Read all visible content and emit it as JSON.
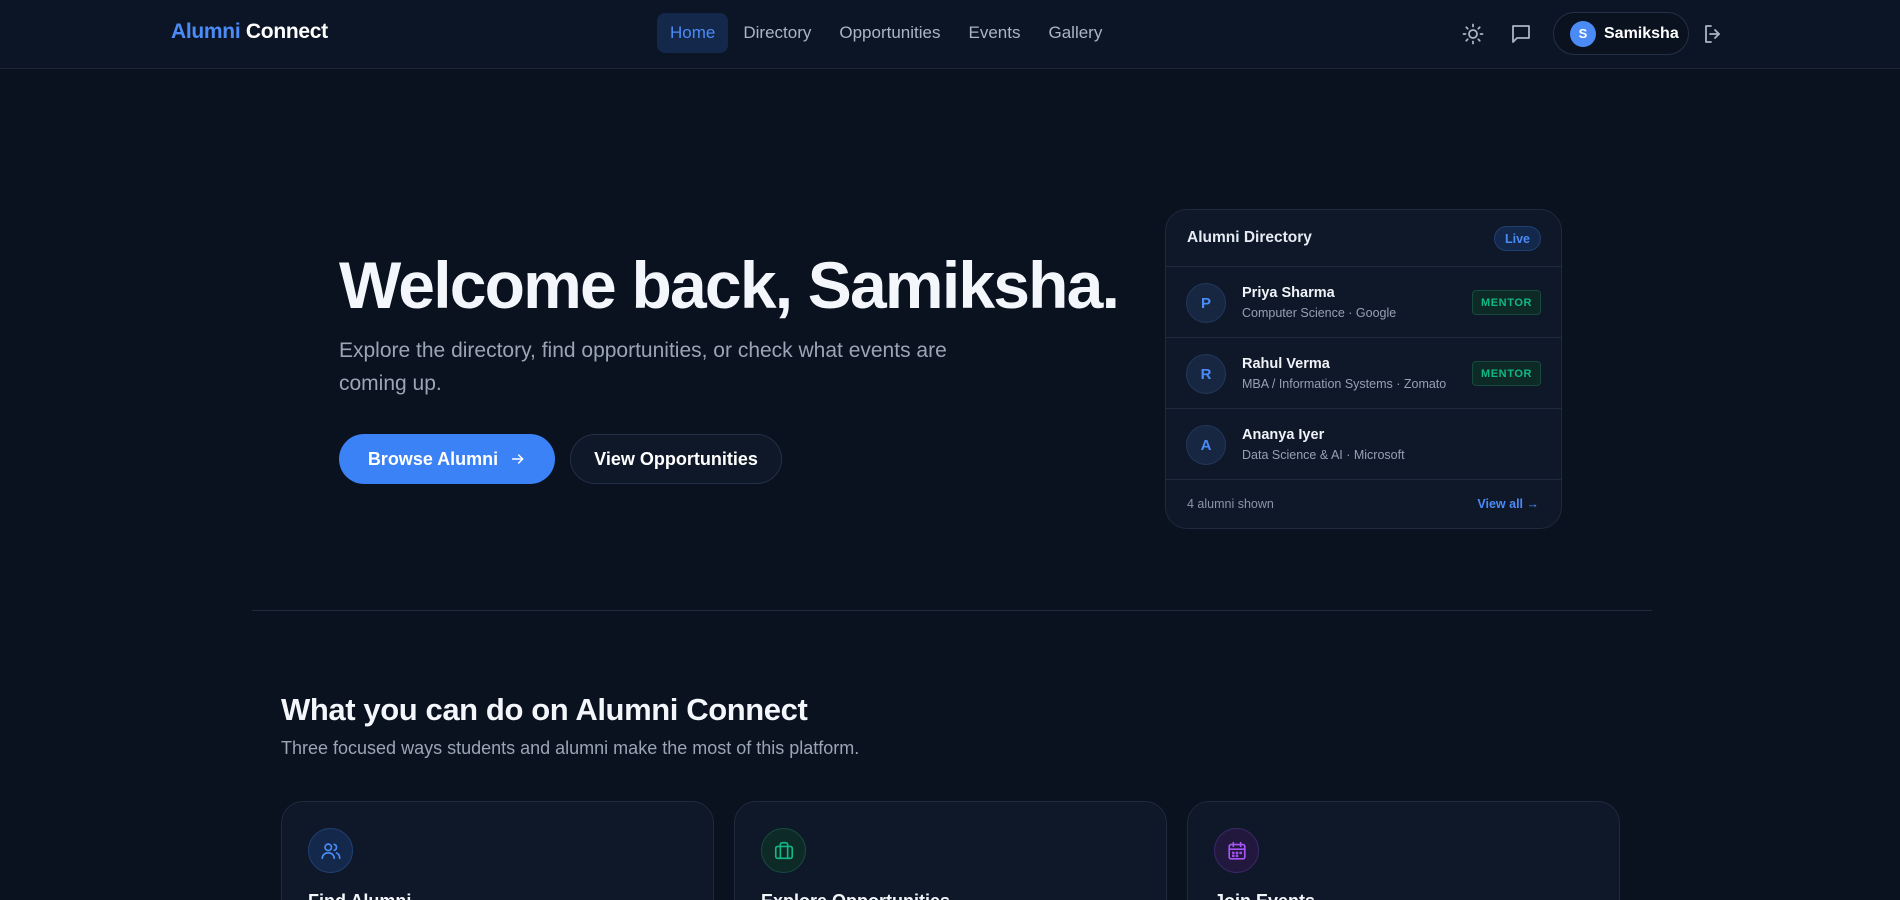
{
  "brand": {
    "part1": "Alumni",
    "part2": "Connect"
  },
  "nav": {
    "items": [
      {
        "label": "Home",
        "active": true
      },
      {
        "label": "Directory",
        "active": false
      },
      {
        "label": "Opportunities",
        "active": false
      },
      {
        "label": "Events",
        "active": false
      },
      {
        "label": "Gallery",
        "active": false
      }
    ]
  },
  "header_icons": [
    "sun-icon",
    "chat-icon",
    "logout-icon"
  ],
  "user": {
    "initial": "S",
    "name": "Samiksha"
  },
  "hero": {
    "title": "Welcome back, Samiksha.",
    "subtitle": "Explore the directory, find opportunities, or check what events are coming up.",
    "primary_button": "Browse Alumni",
    "secondary_button": "View Opportunities"
  },
  "directory_card": {
    "title": "Alumni Directory",
    "badge": "Live",
    "rows": [
      {
        "initial": "P",
        "name": "Priya Sharma",
        "meta": "Computer Science · Google",
        "badge": "MENTOR"
      },
      {
        "initial": "R",
        "name": "Rahul Verma",
        "meta": "MBA / Information Systems · Zomato",
        "badge": "MENTOR"
      },
      {
        "initial": "A",
        "name": "Ananya Iyer",
        "meta": "Data Science & AI · Microsoft",
        "badge": ""
      }
    ],
    "footer_count": "4 alumni shown",
    "footer_link": "View all →"
  },
  "section": {
    "title": "What you can do on Alumni Connect",
    "subtitle": "Three focused ways students and alumni make the most of this platform.",
    "features": [
      {
        "title": "Find Alumni",
        "icon": "users-icon",
        "color": "#4b8bf5"
      },
      {
        "title": "Explore Opportunities",
        "icon": "briefcase-icon",
        "color": "#10b981"
      },
      {
        "title": "Join Events",
        "icon": "calendar-icon",
        "color": "#a855f7"
      }
    ]
  },
  "colors": {
    "accent": "#3b82f6",
    "background": "#0a111f",
    "mentor": "#10b981"
  }
}
